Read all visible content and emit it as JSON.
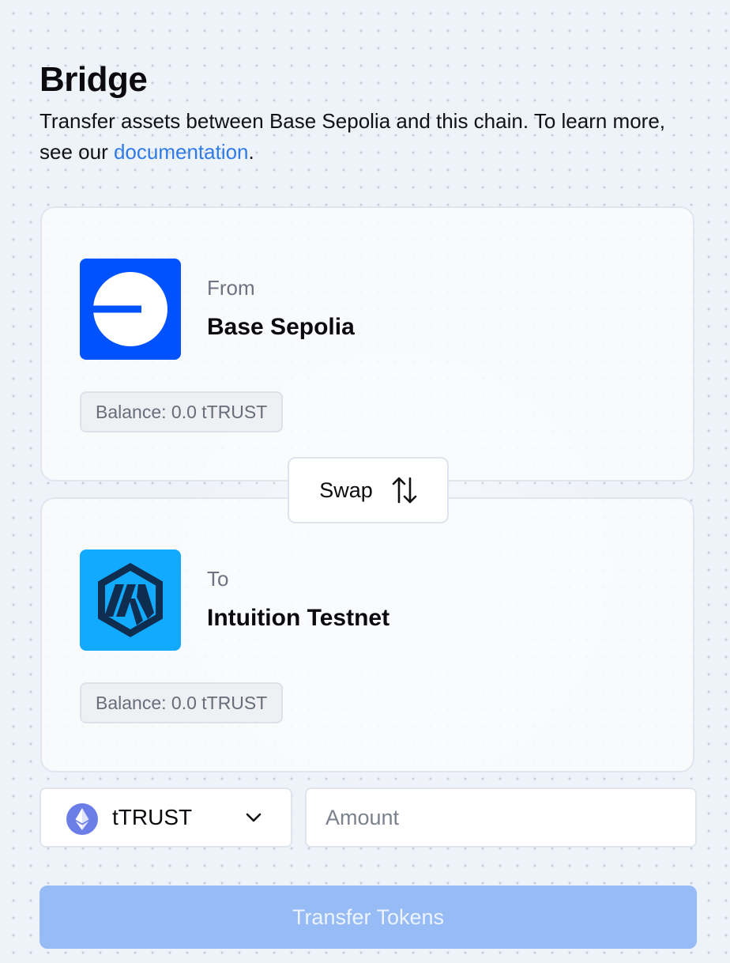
{
  "header": {
    "title": "Bridge",
    "description_prefix": "Transfer assets between Base Sepolia and this chain. To learn more, see our ",
    "documentation_link": "documentation",
    "description_suffix": "."
  },
  "from": {
    "label": "From",
    "chain_name": "Base Sepolia",
    "logo_icon": "base-logo-icon",
    "logo_color": "#0052ff",
    "balance": "Balance: 0.0 tTRUST"
  },
  "swap": {
    "label": "Swap",
    "icon": "swap-arrows-icon"
  },
  "to": {
    "label": "To",
    "chain_name": "Intuition Testnet",
    "logo_icon": "intuition-logo-icon",
    "logo_color": "#12aaff",
    "balance": "Balance: 0.0 tTRUST"
  },
  "token_select": {
    "selected": "tTRUST",
    "icon": "ethereum-icon",
    "chevron": "chevron-down-icon"
  },
  "amount_input": {
    "value": "",
    "placeholder": "Amount"
  },
  "transfer_button": {
    "label": "Transfer Tokens",
    "disabled": true,
    "color": "#97bbf5"
  },
  "colors": {
    "link": "#2f7be6",
    "background": "#eef2f9"
  }
}
